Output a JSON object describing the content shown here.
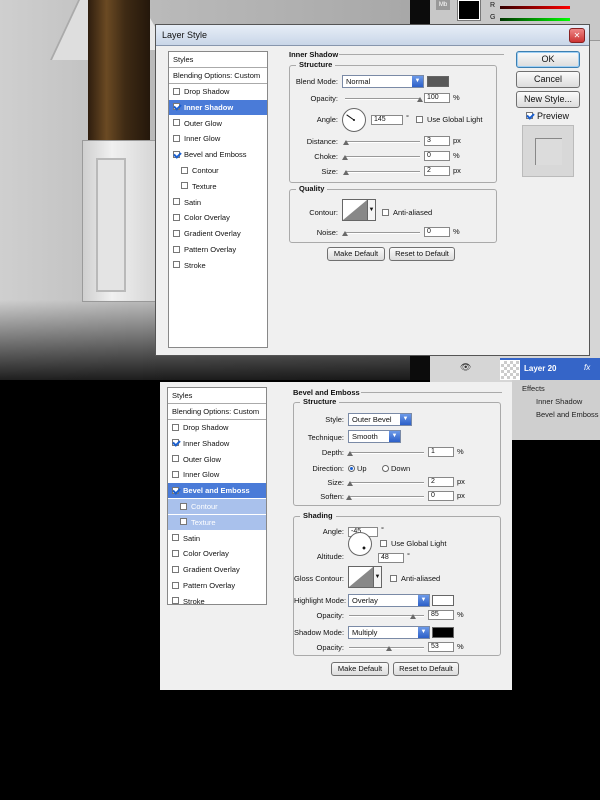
{
  "ps_panel": {
    "mb_label": "Mb",
    "r_label": "R",
    "g_label": "G",
    "layer_name": "Layer 20",
    "fx_badge": "fx",
    "effects_label": "Effects",
    "effects": [
      "Inner Shadow",
      "Bevel and Emboss"
    ]
  },
  "top_dialog": {
    "title": "Layer Style",
    "close_glyph": "✕",
    "style_list": [
      {
        "label": "Styles",
        "kind": "head"
      },
      {
        "label": "Blending Options: Custom",
        "kind": "head"
      },
      {
        "label": "Drop Shadow",
        "checked": false
      },
      {
        "label": "Inner Shadow",
        "checked": true,
        "selected": true
      },
      {
        "label": "Outer Glow",
        "checked": false
      },
      {
        "label": "Inner Glow",
        "checked": false
      },
      {
        "label": "Bevel and Emboss",
        "checked": true
      },
      {
        "label": "Contour",
        "checked": false,
        "sub": true
      },
      {
        "label": "Texture",
        "checked": false,
        "sub": true
      },
      {
        "label": "Satin",
        "checked": false
      },
      {
        "label": "Color Overlay",
        "checked": false
      },
      {
        "label": "Gradient Overlay",
        "checked": false
      },
      {
        "label": "Pattern Overlay",
        "checked": false
      },
      {
        "label": "Stroke",
        "checked": false
      }
    ],
    "section_title": "Inner Shadow",
    "structure": {
      "legend": "Structure",
      "blend_mode_label": "Blend Mode:",
      "blend_mode": "Normal",
      "opacity_label": "Opacity:",
      "opacity": "100",
      "opacity_unit": "%",
      "opacity_level": 1.0,
      "angle_label": "Angle:",
      "angle": "145",
      "angle_unit": "°",
      "angle_deg": 145,
      "global_light_label": "Use Global Light",
      "distance_label": "Distance:",
      "distance": "3",
      "distance_unit": "px",
      "distance_level": 0.01,
      "choke_label": "Choke:",
      "choke": "0",
      "choke_unit": "%",
      "choke_level": 0,
      "size_label": "Size:",
      "size": "2",
      "size_unit": "px",
      "size_level": 0.01,
      "shadow_color": "#595959"
    },
    "quality": {
      "legend": "Quality",
      "contour_label": "Contour:",
      "anti_aliased_label": "Anti-aliased",
      "noise_label": "Noise:",
      "noise": "0",
      "noise_unit": "%",
      "noise_level": 0
    },
    "make_default": "Make Default",
    "reset_default": "Reset to Default",
    "ok": "OK",
    "cancel": "Cancel",
    "new_style": "New Style...",
    "preview_label": "Preview"
  },
  "bottom_dialog": {
    "style_list": [
      {
        "label": "Styles",
        "kind": "head"
      },
      {
        "label": "Blending Options: Custom",
        "kind": "head"
      },
      {
        "label": "Drop Shadow",
        "checked": false
      },
      {
        "label": "Inner Shadow",
        "checked": true
      },
      {
        "label": "Outer Glow",
        "checked": false
      },
      {
        "label": "Inner Glow",
        "checked": false
      },
      {
        "label": "Bevel and Emboss",
        "checked": true,
        "selected": true
      },
      {
        "label": "Contour",
        "checked": false,
        "sub": true,
        "subsel": true
      },
      {
        "label": "Texture",
        "checked": false,
        "sub": true,
        "subsel": true
      },
      {
        "label": "Satin",
        "checked": false
      },
      {
        "label": "Color Overlay",
        "checked": false
      },
      {
        "label": "Gradient Overlay",
        "checked": false
      },
      {
        "label": "Pattern Overlay",
        "checked": false
      },
      {
        "label": "Stroke",
        "checked": false
      }
    ],
    "section_title": "Bevel and Emboss",
    "structure": {
      "legend": "Structure",
      "style_label": "Style:",
      "style": "Outer Bevel",
      "technique_label": "Technique:",
      "technique": "Smooth",
      "depth_label": "Depth:",
      "depth": "1",
      "depth_unit": "%",
      "depth_level": 0.01,
      "direction_label": "Direction:",
      "up_label": "Up",
      "down_label": "Down",
      "size_label": "Size:",
      "size": "2",
      "size_unit": "px",
      "size_level": 0.01,
      "soften_label": "Soften:",
      "soften": "0",
      "soften_unit": "px",
      "soften_level": 0
    },
    "shading": {
      "legend": "Shading",
      "angle_label": "Angle:",
      "angle": "-45",
      "angle_unit": "°",
      "global_light_label": "Use Global Light",
      "altitude_label": "Altitude:",
      "altitude": "48",
      "altitude_unit": "°",
      "gloss_label": "Gloss Contour:",
      "anti_aliased_label": "Anti-aliased",
      "highlight_mode_label": "Highlight Mode:",
      "highlight_mode": "Overlay",
      "highlight_color": "#ffffff",
      "hl_opacity_label": "Opacity:",
      "hl_opacity": "85",
      "hl_opacity_unit": "%",
      "hl_opacity_level": 0.85,
      "shadow_mode_label": "Shadow Mode:",
      "shadow_mode": "Multiply",
      "shadow_color": "#000000",
      "sh_opacity_label": "Opacity:",
      "sh_opacity": "53",
      "sh_opacity_unit": "%",
      "sh_opacity_level": 0.53
    },
    "make_default": "Make Default",
    "reset_default": "Reset to Default"
  }
}
